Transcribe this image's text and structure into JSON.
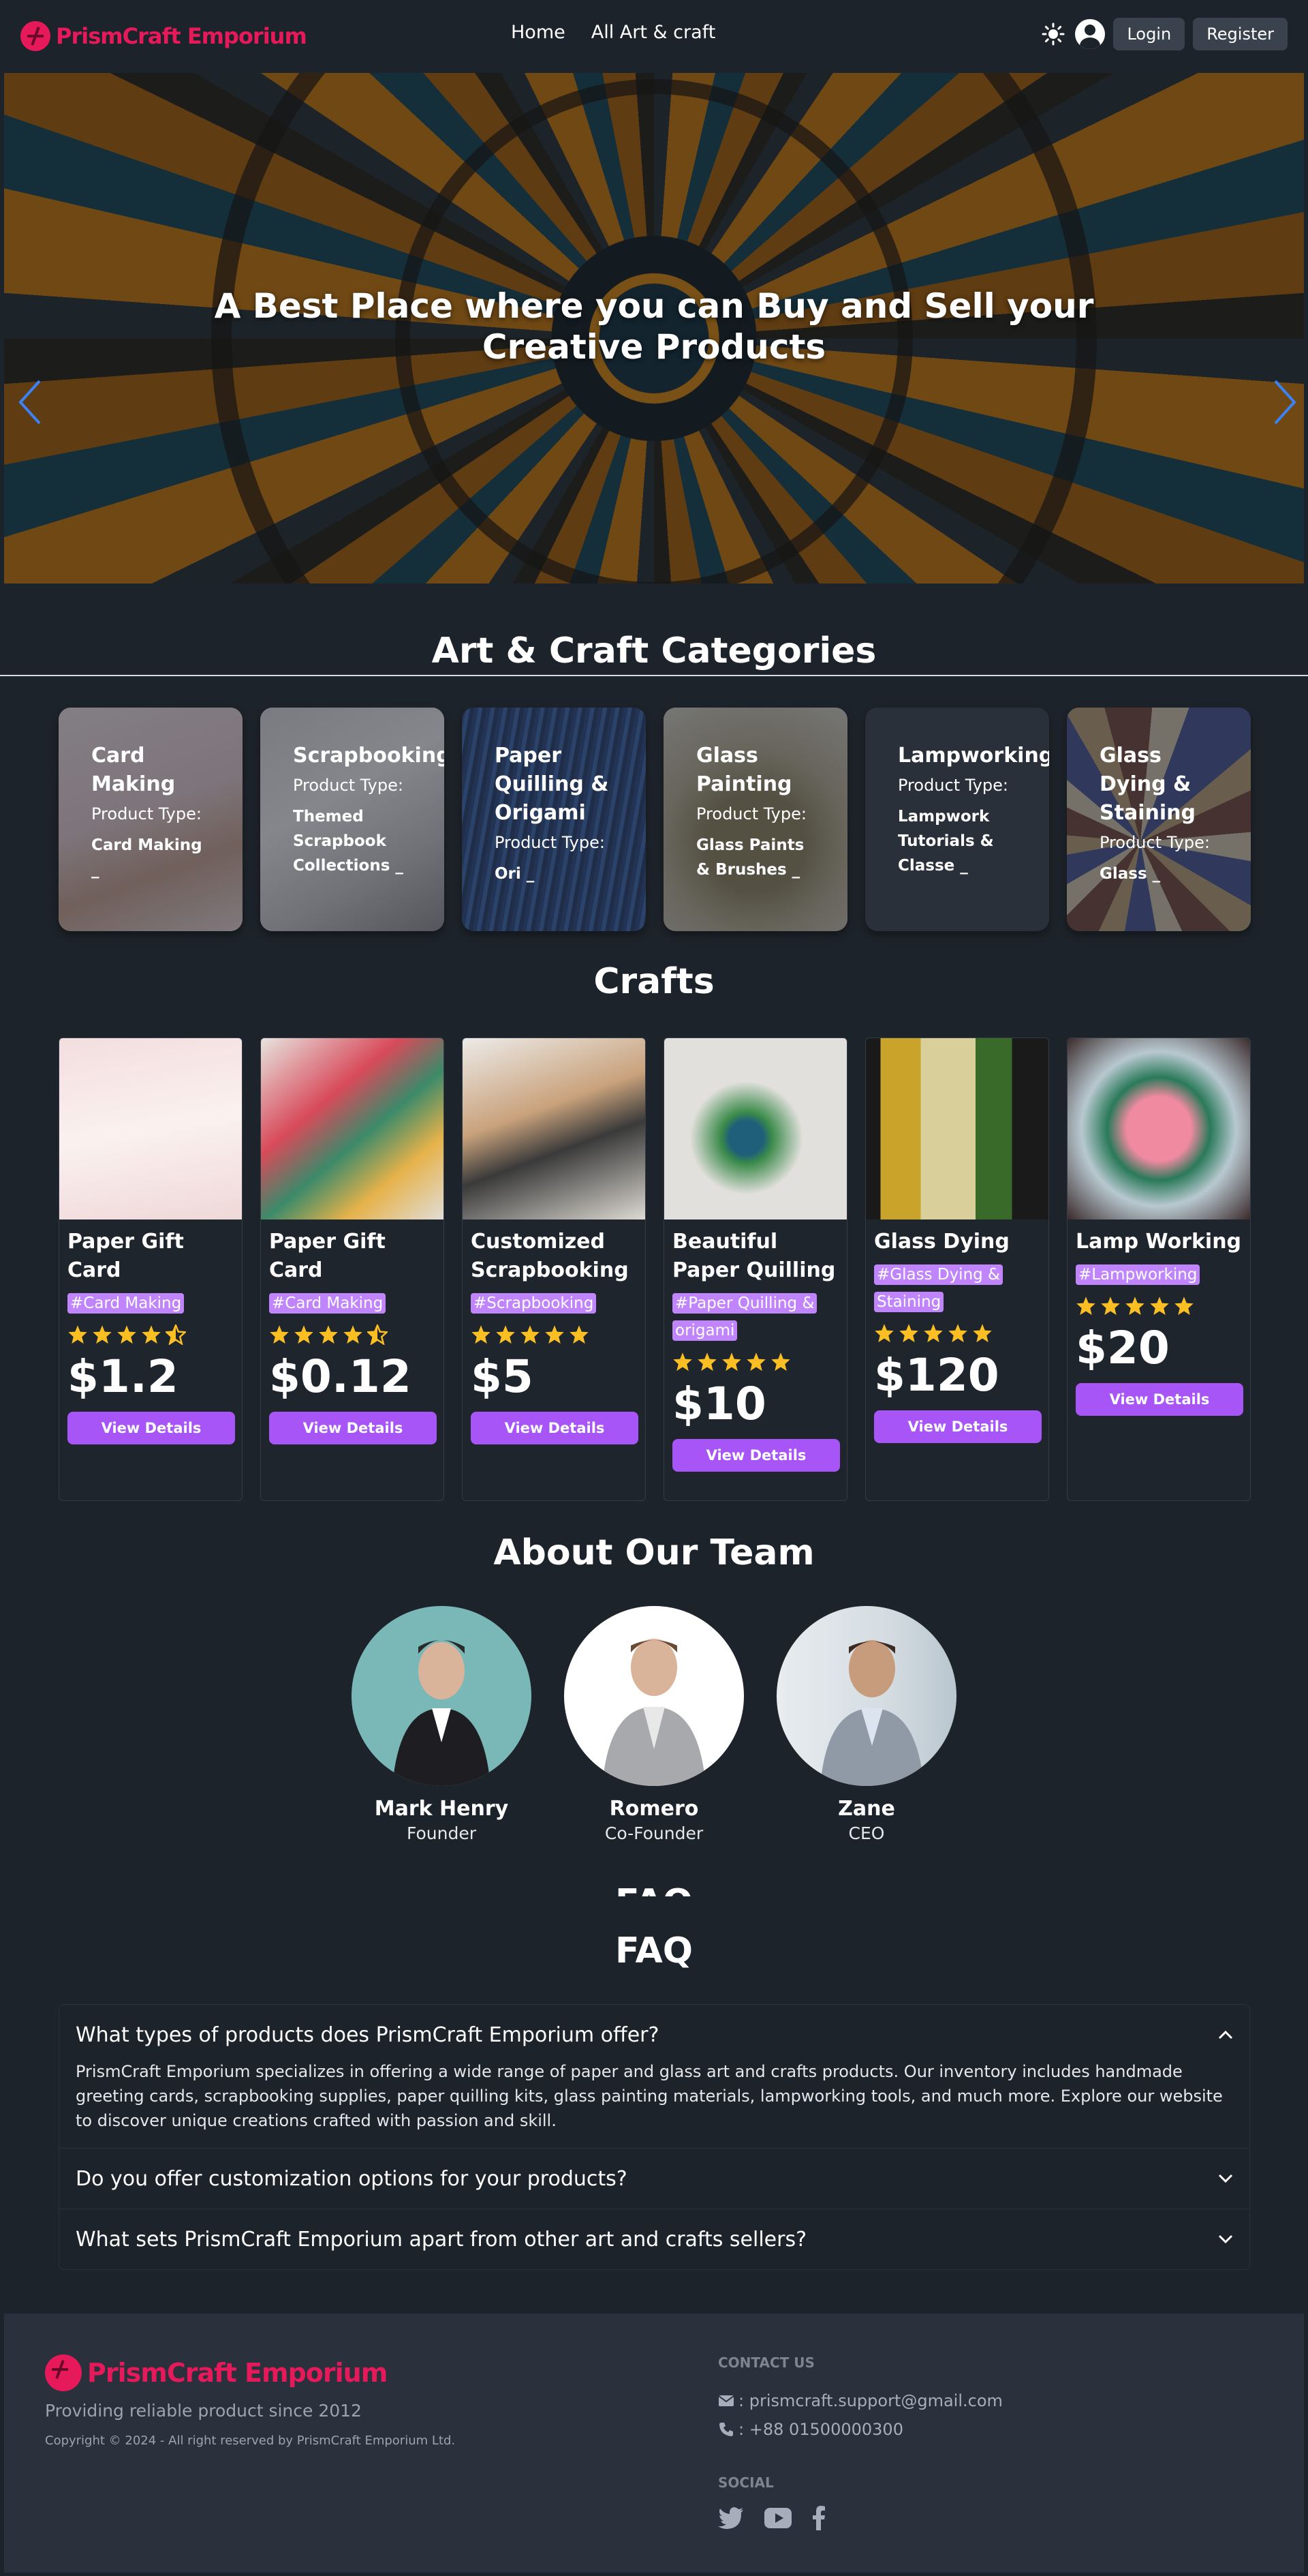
{
  "brand": {
    "name": "PrismCraft Emporium"
  },
  "nav": {
    "links": [
      "Home",
      "All Art & craft"
    ],
    "login_label": "Login",
    "register_label": "Register"
  },
  "hero": {
    "title": "A Best Place where you can Buy and Sell your Creative Products"
  },
  "categories": {
    "title": "Art & Craft Categories",
    "type_label": "Product Type:",
    "items": [
      {
        "name": "Card Making",
        "type_value": "Card Making _"
      },
      {
        "name": "Scrapbooking",
        "type_value": "Themed Scrapbook Collections _"
      },
      {
        "name": "Paper Quilling & Origami",
        "type_value": "Ori _"
      },
      {
        "name": "Glass Painting",
        "type_value": "Glass Paints & Brushes _"
      },
      {
        "name": "Lampworking",
        "type_value": "Lampwork Tutorials & Classe _"
      },
      {
        "name": "Glass Dying & Staining",
        "type_value": "Glass _"
      }
    ]
  },
  "crafts": {
    "title": "Crafts",
    "view_label": "View Details",
    "items": [
      {
        "name": "Paper Gift Card",
        "tag": "#Card Making",
        "rating": 4.5,
        "price": "$1.2"
      },
      {
        "name": "Paper Gift Card",
        "tag": "#Card Making",
        "rating": 4.5,
        "price": "$0.12"
      },
      {
        "name": "Customized Scrapbooking",
        "tag": "#Scrapbooking",
        "rating": 5,
        "price": "$5"
      },
      {
        "name": "Beautiful Paper Quilling",
        "tag": "#Paper Quilling & origami",
        "rating": 5,
        "price": "$10"
      },
      {
        "name": "Glass Dying",
        "tag": "#Glass Dying & Staining",
        "rating": 5,
        "price": "$120"
      },
      {
        "name": "Lamp Working",
        "tag": "#Lampworking",
        "rating": 5,
        "price": "$20"
      }
    ]
  },
  "team": {
    "title": "About Our Team",
    "members": [
      {
        "name": "Mark Henry",
        "role": "Founder"
      },
      {
        "name": "Romero",
        "role": "Co-Founder"
      },
      {
        "name": "Zane",
        "role": "CEO"
      }
    ]
  },
  "faq": {
    "title": "FAQ",
    "items": [
      {
        "question": "What types of products does PrismCraft Emporium offer?",
        "answer": "PrismCraft Emporium specializes in offering a wide range of paper and glass art and crafts products. Our inventory includes handmade greeting cards, scrapbooking supplies, paper quilling kits, glass painting materials, lampworking tools, and much more. Explore our website to discover unique creations crafted with passion and skill.",
        "open": true
      },
      {
        "question": "Do you offer customization options for your products?",
        "open": false
      },
      {
        "question": "What sets PrismCraft Emporium apart from other art and crafts sellers?",
        "open": false
      }
    ]
  },
  "footer": {
    "tagline": "Providing reliable product since 2012",
    "copyright": "Copyright © 2024 - All right reserved by PrismCraft Emporium Ltd.",
    "contact_heading": "CONTACT US",
    "email": ": prismcraft.support@gmail.com",
    "phone": ": +88 01500000300",
    "social_heading": "SOCIAL"
  },
  "colors": {
    "background": "#1d232a",
    "brand": "#e6195a",
    "accent": "#a855f7",
    "tag": "#c084fc",
    "star": "#fbbf24",
    "carousel_dot": "#3b82f6"
  },
  "icons": [
    "sun-icon",
    "user-icon",
    "chevron-left-icon",
    "chevron-right-icon",
    "star-icon",
    "chevron-up-icon",
    "chevron-down-icon",
    "mail-icon",
    "phone-icon",
    "twitter-icon",
    "youtube-icon",
    "facebook-icon"
  ]
}
